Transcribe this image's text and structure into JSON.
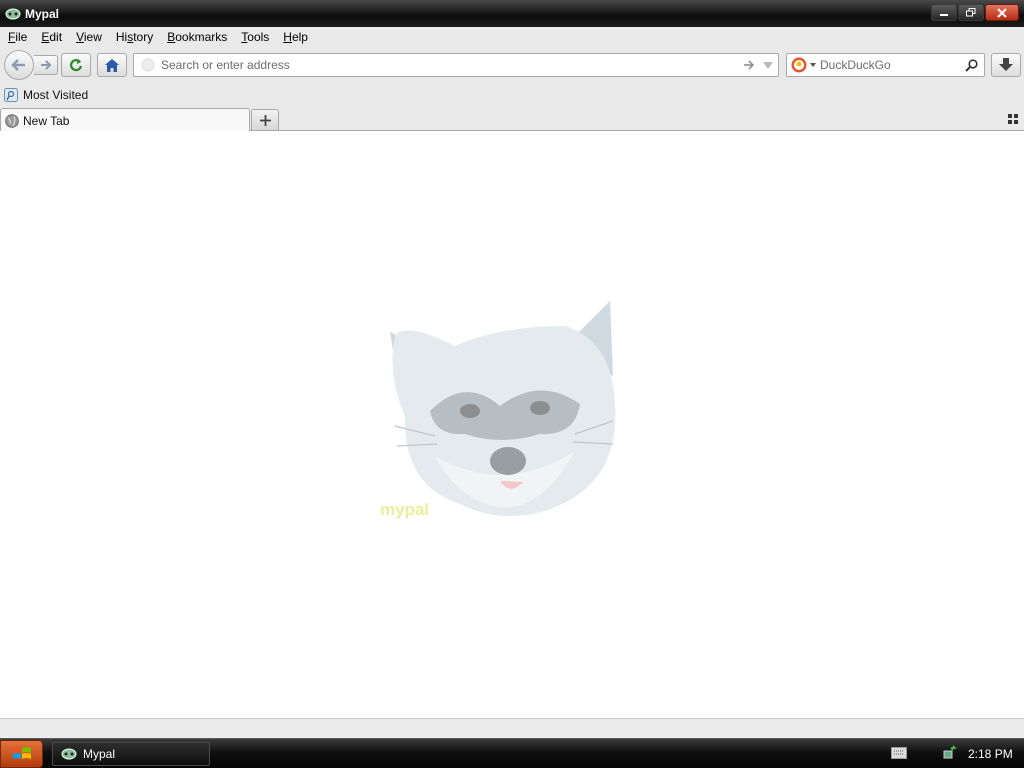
{
  "window": {
    "title": "Mypal",
    "controls": [
      "minimize",
      "restore",
      "close"
    ]
  },
  "menu": {
    "items": [
      {
        "label": "File",
        "access": "F"
      },
      {
        "label": "Edit",
        "access": "E"
      },
      {
        "label": "View",
        "access": "V"
      },
      {
        "label": "History",
        "access": "s"
      },
      {
        "label": "Bookmarks",
        "access": "B"
      },
      {
        "label": "Tools",
        "access": "T"
      },
      {
        "label": "Help",
        "access": "H"
      }
    ]
  },
  "navbar": {
    "url_placeholder": "Search or enter address",
    "search_engine": "DuckDuckGo",
    "search_placeholder": "DuckDuckGo"
  },
  "bookmarks": {
    "items": [
      {
        "label": "Most Visited",
        "icon": "bookmark-folder-icon"
      }
    ]
  },
  "tabs": [
    {
      "label": "New Tab",
      "active": true,
      "icon": "globe-icon"
    }
  ],
  "content": {
    "logo_text": "mypal",
    "logo": "raccoon-logo"
  },
  "taskbar": {
    "task_label": "Mypal",
    "clock": "2:18 PM"
  },
  "colors": {
    "titlebar": "#1a1a1a",
    "toolbar": "#e9e9e9",
    "close_button": "#c8391c",
    "start_button": "#d0551f",
    "home_icon": "#2a5aa8"
  }
}
